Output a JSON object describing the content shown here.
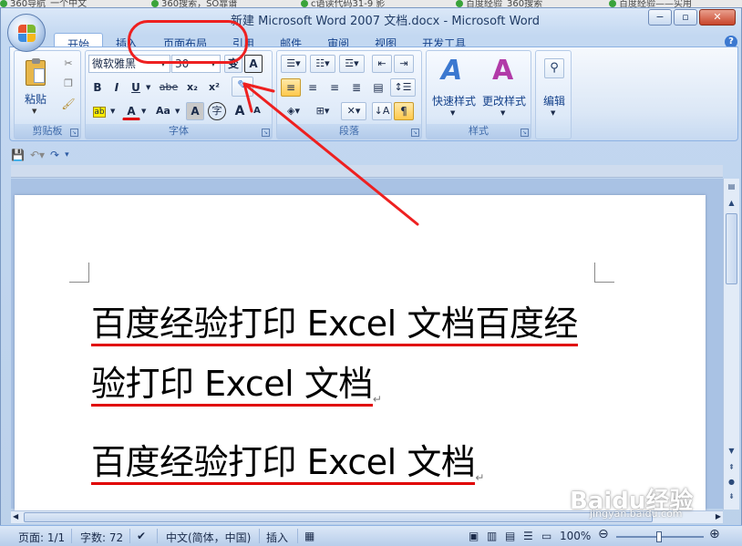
{
  "browser_tabs": [
    "360导航_一个中文",
    "360搜索，SO靠谱",
    "c语读代码31-9 影",
    "百度经验_360搜索",
    "百度经验——实用"
  ],
  "window": {
    "title": "新建 Microsoft Word 2007 文档.docx - Microsoft Word",
    "minimize": "−",
    "restore": "▫",
    "close": "✕"
  },
  "ribbon_tabs": [
    "开始",
    "插入",
    "页面布局",
    "引用",
    "邮件",
    "审阅",
    "视图",
    "开发工具"
  ],
  "active_tab": "开始",
  "help": "?",
  "ribbon": {
    "clipboard": {
      "label": "剪贴板",
      "paste": "粘贴"
    },
    "font": {
      "label": "字体",
      "font_name": "微软雅黑",
      "font_size": "30",
      "bold": "B",
      "italic": "I",
      "underline": "U",
      "strike": "abe",
      "subscript": "x₂",
      "superscript": "x²",
      "font_color": "A",
      "change_case": "Aa",
      "char_shading": "A",
      "enclose": "字",
      "grow": "A",
      "shrink": "A",
      "phonetic": "变",
      "char_border": "A"
    },
    "paragraph": {
      "label": "段落"
    },
    "styles": {
      "label": "样式",
      "quick_styles": "快速样式",
      "change_styles": "更改样式"
    },
    "editing": {
      "label": "编辑"
    }
  },
  "document": {
    "lines": [
      "百度经验打印 Excel 文档百度经",
      "验打印 Excel 文档",
      "百度经验打印 Excel 文档"
    ],
    "para_mark": "↵"
  },
  "status": {
    "page": "页面: 1/1",
    "words": "字数: 72",
    "language": "中文(简体，中国)",
    "mode": "插入",
    "zoom": "100%"
  },
  "watermark": {
    "brand": "Baidu经验",
    "url": "jingyan.baidu.com"
  },
  "colors": {
    "annotation": "#ee2020",
    "underline": "#e00000"
  }
}
